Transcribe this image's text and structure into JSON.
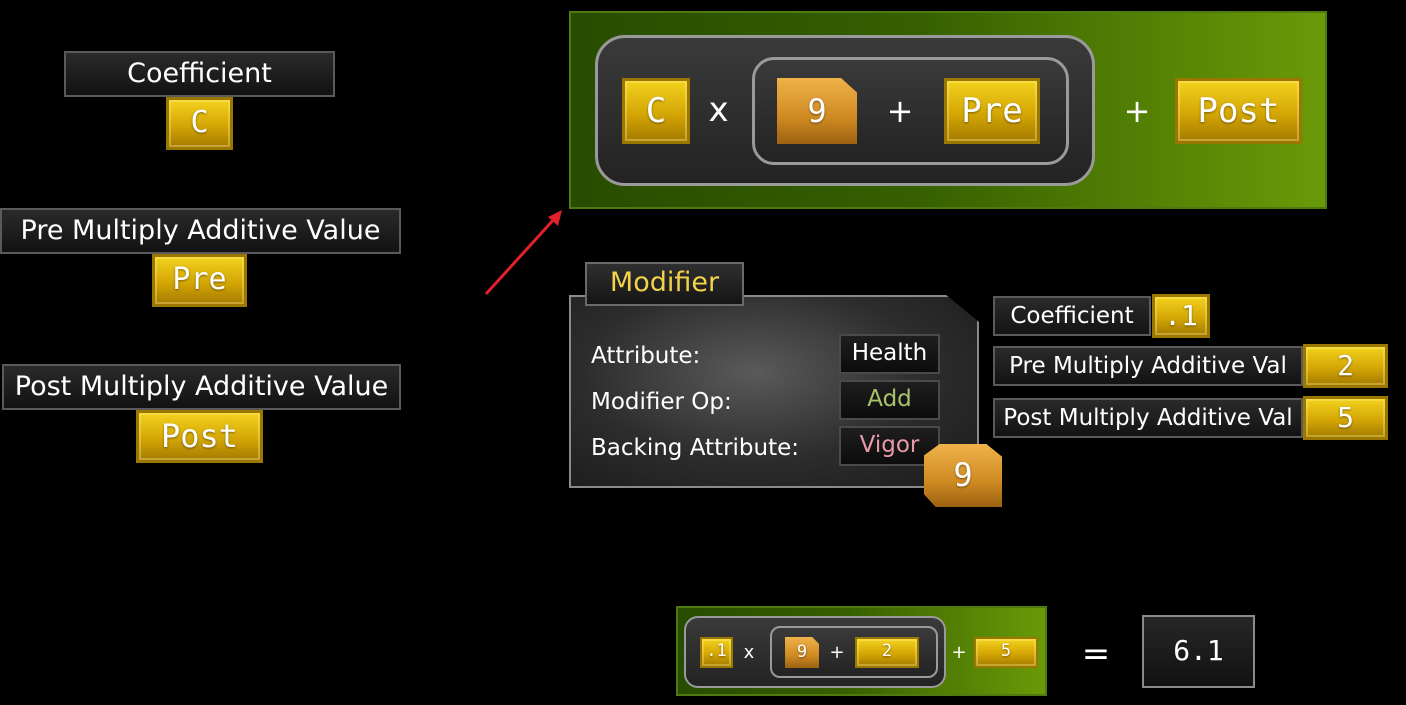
{
  "legend": {
    "coefficient": {
      "label": "Coefficient",
      "token": "C"
    },
    "pre": {
      "label": "Pre Multiply Additive Value",
      "token": "Pre"
    },
    "post": {
      "label": "Post Multiply Additive Value",
      "token": "Post"
    }
  },
  "formula": {
    "coef": "C",
    "times": "x",
    "attr_value": "9",
    "plus1": "+",
    "pre": "Pre",
    "plus2": "+",
    "post": "Post"
  },
  "modifier": {
    "title": "Modifier",
    "rows": [
      {
        "label": "Attribute:",
        "value": "Health",
        "color": "#ffffff"
      },
      {
        "label": "Modifier Op:",
        "value": "Add",
        "color": "#a8c46a"
      },
      {
        "label": "Backing Attribute:",
        "value": "Vigor",
        "color": "#e89aa8"
      }
    ],
    "backing_value": "9"
  },
  "params": [
    {
      "label": "Coefficient",
      "value": ".1"
    },
    {
      "label": "Pre Multiply Additive Val",
      "value": "2"
    },
    {
      "label": "Post Multiply Additive Val",
      "value": "5"
    }
  ],
  "example": {
    "coef": ".1",
    "times": "x",
    "attr_value": "9",
    "plus1": "+",
    "pre": "2",
    "plus2": "+",
    "post": "5",
    "equals": "=",
    "result": "6.1"
  },
  "colors": {
    "arrow": "#e0202a",
    "gold": "#d4a605",
    "green": "#355f00"
  }
}
